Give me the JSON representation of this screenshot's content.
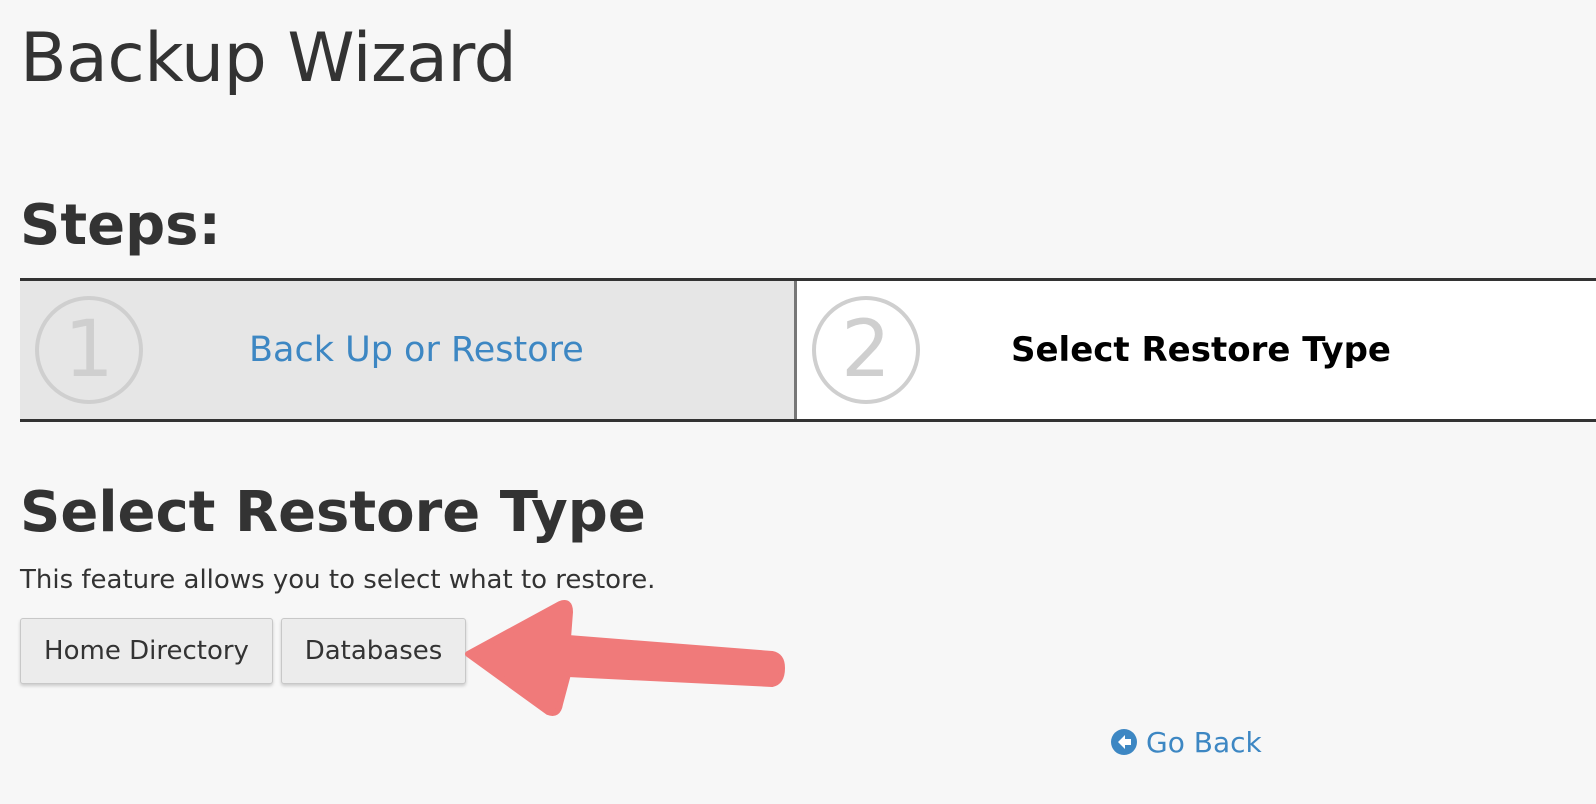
{
  "page": {
    "title": "Backup Wizard"
  },
  "steps": {
    "heading": "Steps:",
    "items": [
      {
        "number": "1",
        "label": "Back Up or Restore",
        "state": "link"
      },
      {
        "number": "2",
        "label": "Select Restore Type",
        "state": "current"
      }
    ]
  },
  "section": {
    "heading": "Select Restore Type",
    "description": "This feature allows you to select what to restore."
  },
  "buttons": {
    "home_directory": "Home Directory",
    "databases": "Databases"
  },
  "annotation": {
    "icon": "arrow-left-icon",
    "color": "#f07a7a"
  },
  "navigation": {
    "go_back": "Go Back",
    "go_back_icon": "circle-arrow-left-icon"
  },
  "colors": {
    "link": "#3d87c3",
    "text": "#333333",
    "background": "#f7f7f7"
  }
}
